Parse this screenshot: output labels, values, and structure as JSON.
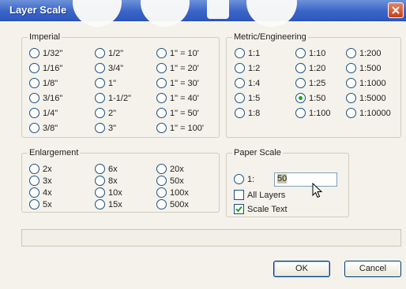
{
  "window": {
    "title": "Layer Scale"
  },
  "imperial": {
    "title": "Imperial",
    "col1": [
      "1/32\"",
      "1/16\"",
      "1/8\"",
      "3/16\"",
      "1/4\"",
      "3/8\""
    ],
    "col2": [
      "1/2\"",
      "3/4\"",
      "1\"",
      "1-1/2\"",
      "2\"",
      "3\""
    ],
    "col3": [
      "1\" = 10'",
      "1\" = 20'",
      "1\" = 30'",
      "1\" = 40'",
      "1\" = 50'",
      "1\" = 100'"
    ]
  },
  "metric": {
    "title": "Metric/Engineering",
    "col1": [
      "1:1",
      "1:2",
      "1:4",
      "1:5",
      "1:8"
    ],
    "col2": [
      "1:10",
      "1:20",
      "1:25",
      "1:50",
      "1:100"
    ],
    "col3": [
      "1:200",
      "1:500",
      "1:1000",
      "1:5000",
      "1:10000"
    ],
    "selected": "1:50"
  },
  "enlargement": {
    "title": "Enlargement",
    "col1": [
      "2x",
      "3x",
      "4x",
      "5x"
    ],
    "col2": [
      "6x",
      "8x",
      "10x",
      "15x"
    ],
    "col3": [
      "20x",
      "50x",
      "100x",
      "500x"
    ]
  },
  "paper_scale": {
    "title": "Paper Scale",
    "radio_label": "1:",
    "value": "50",
    "all_layers_label": "All Layers",
    "all_layers_checked": false,
    "scale_text_label": "Scale Text",
    "scale_text_checked": true
  },
  "buttons": {
    "ok": "OK",
    "cancel": "Cancel"
  },
  "colors": {
    "titlebar": "#3a64c8",
    "close": "#c7411c",
    "radio_dot": "#21a121"
  }
}
